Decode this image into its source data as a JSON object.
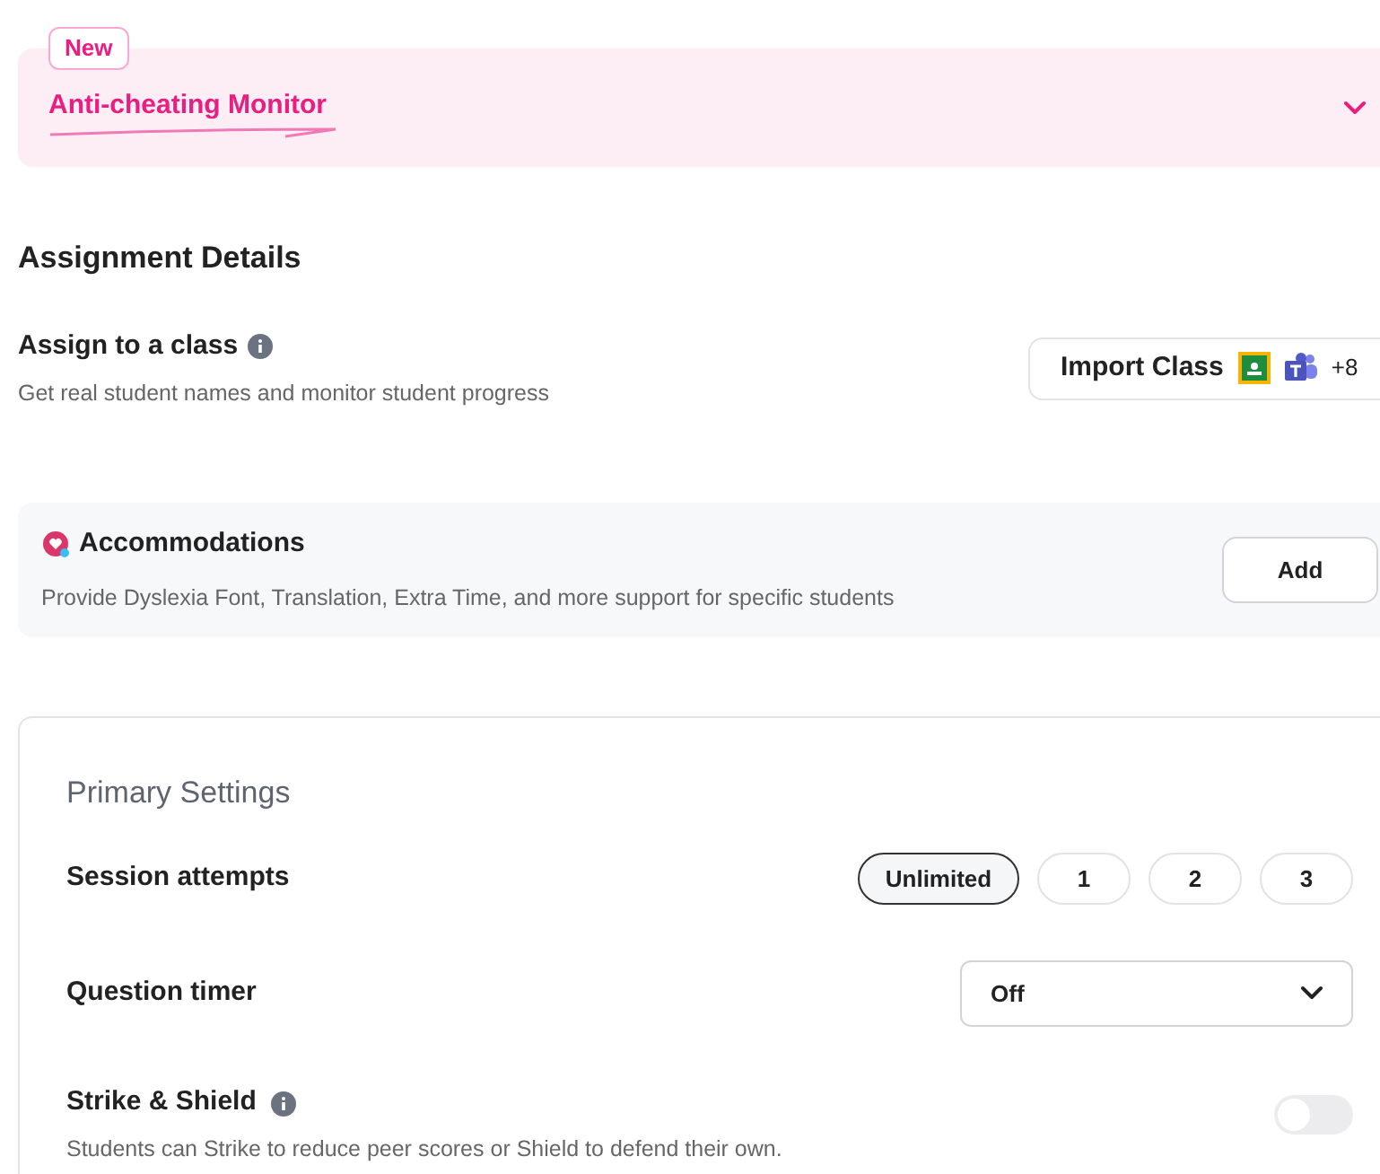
{
  "banner": {
    "badge": "New",
    "title": "Anti-cheating Monitor",
    "expanded": false
  },
  "section_title": "Assignment Details",
  "assign": {
    "title": "Assign to a class",
    "subtitle": "Get real student names and monitor student progress",
    "button": "Import Class",
    "more": "+8"
  },
  "accommodations": {
    "title": "Accommodations",
    "subtitle": "Provide Dyslexia Font, Translation, Extra Time, and more support for specific students",
    "button": "Add"
  },
  "settings": {
    "title": "Primary Settings",
    "rows": [
      {
        "kind": "choices",
        "label": "Session attempts",
        "options": [
          {
            "label": "Unlimited",
            "selected": true
          },
          {
            "label": "1",
            "selected": false
          },
          {
            "label": "2",
            "selected": false
          },
          {
            "label": "3",
            "selected": false
          }
        ]
      },
      {
        "kind": "dropdown",
        "label": "Question timer",
        "value": "Off"
      },
      {
        "kind": "toggle",
        "label": "Strike & Shield",
        "description": "Students can Strike to reduce peer scores or Shield to defend their own.",
        "on": false
      }
    ]
  }
}
